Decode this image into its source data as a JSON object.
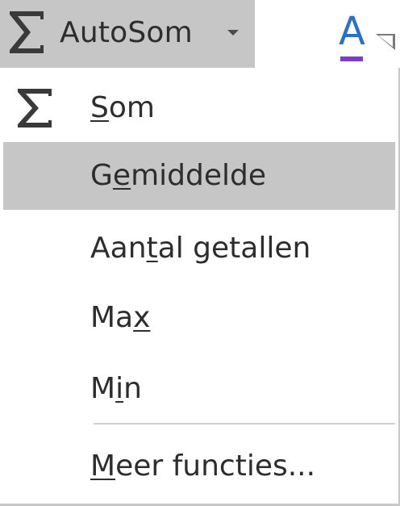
{
  "ribbon": {
    "autosum": {
      "icon": "sigma-icon",
      "label": "AutoSom"
    },
    "font_color": {
      "icon": "font-color-icon",
      "letter": "A",
      "swatch_color": "#7a3fc6",
      "letter_color": "#2f6fc2"
    }
  },
  "menu": {
    "items": [
      {
        "pre": "",
        "key": "S",
        "post": "om",
        "icon": "sigma-icon",
        "highlighted": false
      },
      {
        "pre": "G",
        "key": "e",
        "post": "middelde",
        "highlighted": true
      },
      {
        "pre": "Aan",
        "key": "t",
        "post": "al getallen",
        "highlighted": false
      },
      {
        "pre": "Ma",
        "key": "x",
        "post": "",
        "highlighted": false
      },
      {
        "pre": "M",
        "key": "i",
        "post": "n",
        "highlighted": false
      },
      {
        "pre": "",
        "key": "M",
        "post": "eer functies...",
        "highlighted": false
      }
    ]
  },
  "colors": {
    "highlight": "#c6c6c6",
    "text": "#2d2d2d",
    "border": "#c8c8c8"
  }
}
